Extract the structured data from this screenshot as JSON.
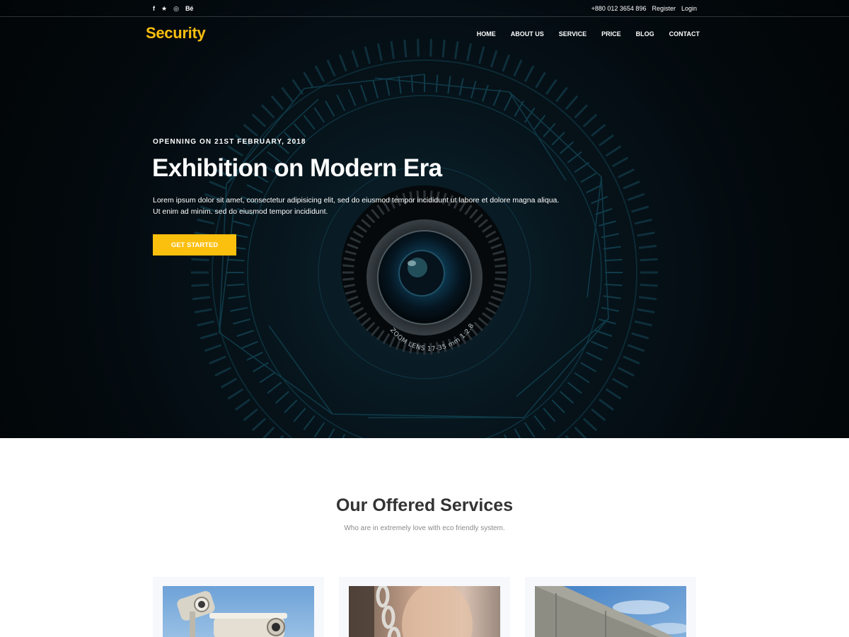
{
  "topbar": {
    "social": [
      {
        "icon": "facebook-icon",
        "glyph": "f"
      },
      {
        "icon": "twitter-icon",
        "glyph": "★"
      },
      {
        "icon": "dribbble-icon",
        "glyph": "◎"
      },
      {
        "icon": "behance-icon",
        "glyph": "Bé"
      }
    ],
    "phone": "+880 012 3654 896",
    "register": "Register",
    "login": "Login"
  },
  "header": {
    "logo": "Security",
    "nav": [
      "HOME",
      "ABOUT US",
      "SERVICE",
      "PRICE",
      "BLOG",
      "CONTACT"
    ]
  },
  "hero": {
    "eyebrow": "OPENNING ON 21ST FEBRUARY, 2018",
    "title": "Exhibition on Modern Era",
    "text": "Lorem ipsum dolor sit amet, consectetur adipisicing elit, sed do eiusmod tempor incididunt ut labore et dolore magna aliqua. Ut enim ad minim. sed do eiusmod tempor incididunt.",
    "cta": "GET STARTED",
    "lens_text": "ZOOM LENS 17-35 mm 1:2.8"
  },
  "services": {
    "title": "Our Offered Services",
    "subtitle": "Who are in extremely love with eco friendly system.",
    "cards": [
      {
        "image": "cctv-cameras"
      },
      {
        "image": "chain-lock"
      },
      {
        "image": "security-wall"
      }
    ]
  },
  "colors": {
    "accent": "#fbbf0e",
    "hero_bg": "#03090d",
    "text_dark": "#333333",
    "text_muted": "#8a8a8a"
  }
}
